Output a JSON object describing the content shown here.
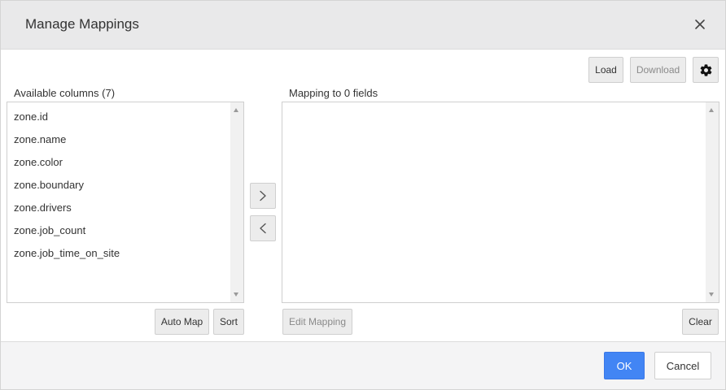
{
  "dialog": {
    "title": "Manage Mappings",
    "close_icon": "close-icon"
  },
  "toolbar": {
    "load_label": "Load",
    "download_label": "Download",
    "settings_icon": "gear-icon"
  },
  "available": {
    "label": "Available columns (7)",
    "items": [
      "zone.id",
      "zone.name",
      "zone.color",
      "zone.boundary",
      "zone.drivers",
      "zone.job_count",
      "zone.job_time_on_site"
    ],
    "auto_map_label": "Auto Map",
    "sort_label": "Sort"
  },
  "transfer": {
    "move_right_icon": "chevron-right-icon",
    "move_left_icon": "chevron-left-icon"
  },
  "mapping": {
    "label": "Mapping to 0 fields",
    "items": [],
    "edit_label": "Edit Mapping",
    "clear_label": "Clear"
  },
  "footer": {
    "ok_label": "OK",
    "cancel_label": "Cancel"
  },
  "colors": {
    "primary": "#4285f4",
    "header_bg": "#e9e9ea",
    "button_bg": "#ececec",
    "footer_bg": "#f4f4f5"
  }
}
